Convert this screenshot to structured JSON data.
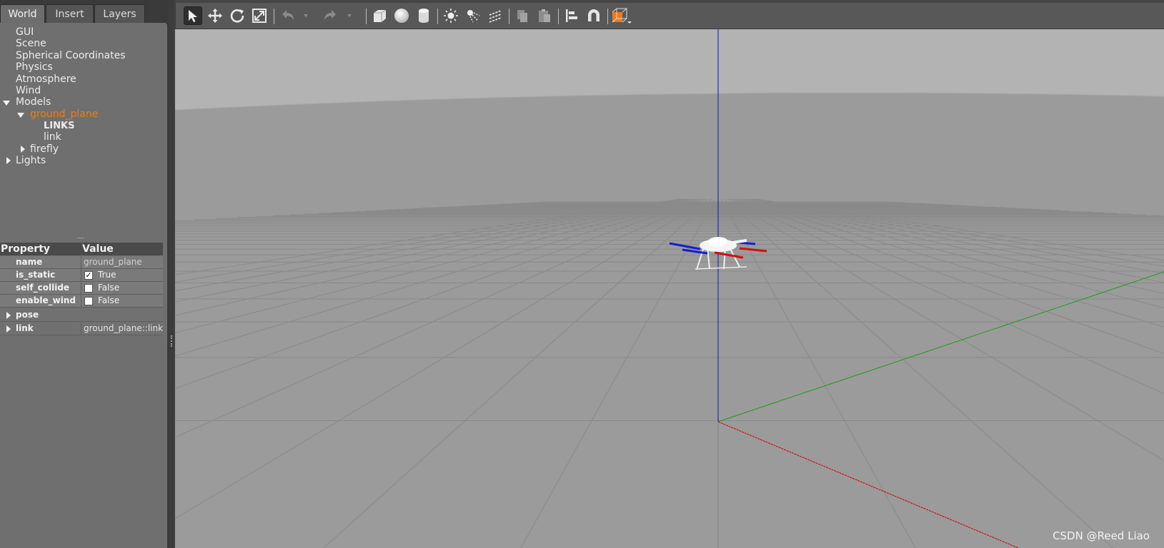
{
  "tabs": [
    {
      "label": "World"
    },
    {
      "label": "Insert"
    },
    {
      "label": "Layers"
    }
  ],
  "tree": {
    "gui": "GUI",
    "scene": "Scene",
    "spherical": "Spherical Coordinates",
    "physics": "Physics",
    "atmosphere": "Atmosphere",
    "wind": "Wind",
    "models": "Models",
    "ground_plane": "ground_plane",
    "links": "LINKS",
    "link": "link",
    "firefly": "firefly",
    "lights": "Lights"
  },
  "properties": {
    "header_property": "Property",
    "header_value": "Value",
    "name_key": "name",
    "name_value": "ground_plane",
    "is_static_key": "is_static",
    "is_static_value": "True",
    "self_collide_key": "self_collide",
    "self_collide_value": "False",
    "enable_wind_key": "enable_wind",
    "enable_wind_value": "False",
    "pose_key": "pose",
    "link_key": "link",
    "link_value": "ground_plane::link"
  },
  "watermark": "CSDN @Reed Liao",
  "colors": {
    "selection": "#f07a1a",
    "axis_x": "#d01010",
    "axis_y": "#18a018",
    "axis_z": "#1010c8",
    "sky": "#b3b3b3",
    "ground": "#9b9b9b"
  }
}
